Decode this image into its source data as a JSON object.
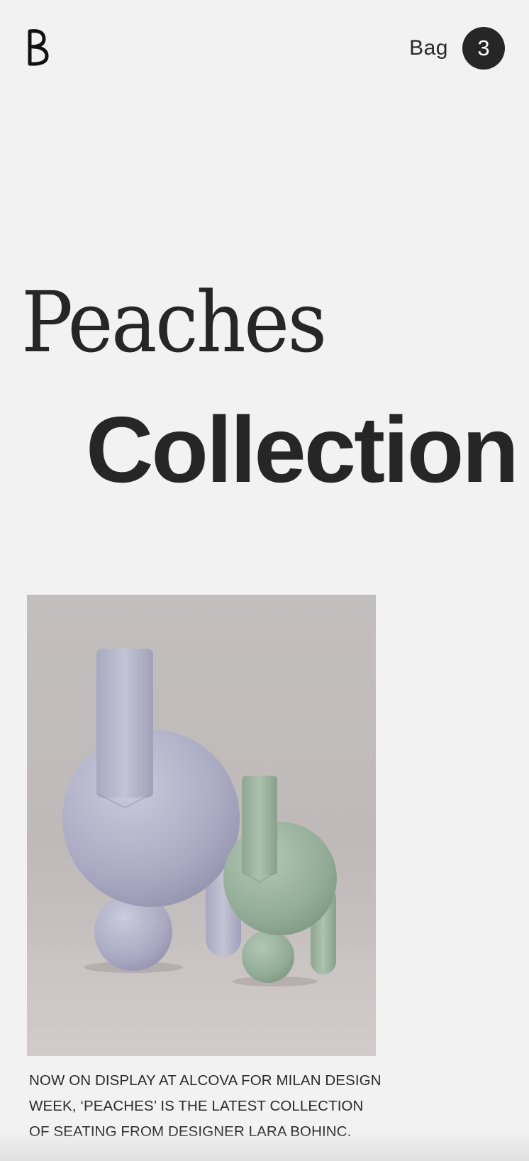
{
  "header": {
    "logo_text": "B",
    "bag_label": "Bag",
    "bag_count": "3"
  },
  "hero": {
    "title_line1": "Peaches",
    "title_line2": "Collection"
  },
  "feature": {
    "image_icon": "stools-sculpture-image",
    "caption": "NOW ON DISPLAY AT ALCOVA FOR MILAN DESIGN WEEK, ‘PEACHES’ IS THE LATEST COLLECTION OF SEATING FROM DESIGNER LARA BOHINC."
  },
  "colors": {
    "background": "#f3f2f2",
    "text": "#262626",
    "badge": "#262626",
    "lavender": "#b8b8cd",
    "sage": "#9fb5a3"
  }
}
